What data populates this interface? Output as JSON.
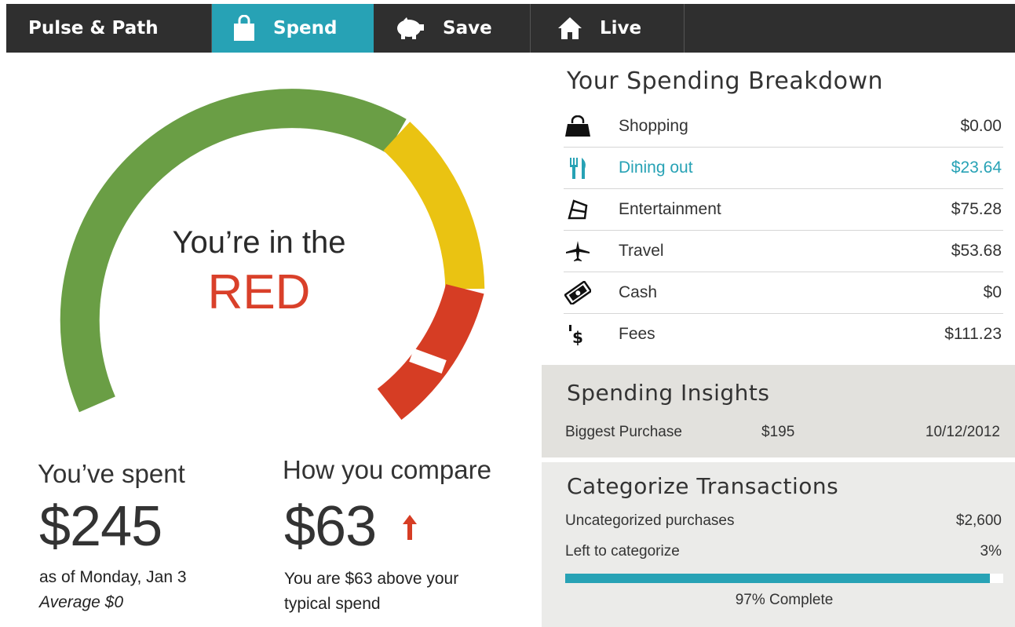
{
  "nav": {
    "brand": "Pulse & Path",
    "tabs": [
      {
        "label": "Spend",
        "icon": "shopping-bag-icon",
        "active": true
      },
      {
        "label": "Save",
        "icon": "piggy-bank-icon",
        "active": false
      },
      {
        "label": "Live",
        "icon": "home-icon",
        "active": false
      }
    ]
  },
  "gauge": {
    "line1": "You’re in the",
    "line2": "RED",
    "status": "red",
    "colors": {
      "green": "#6a9e45",
      "yellow": "#eac312",
      "red": "#d63d24"
    }
  },
  "spent": {
    "heading": "You’ve spent",
    "amount": "$245",
    "as_of": "as of Monday, Jan 3",
    "average": "Average $0"
  },
  "compare": {
    "heading": "How you compare",
    "amount": "$63",
    "line1": "You are $63 above your",
    "line2": "typical spend",
    "direction": "up"
  },
  "breakdown": {
    "title": "Your Spending Breakdown",
    "items": [
      {
        "icon": "shopping-bag-icon",
        "name": "Shopping",
        "amount": "$0.00",
        "highlight": false
      },
      {
        "icon": "fork-knife-icon",
        "name": "Dining out",
        "amount": "$23.64",
        "highlight": true
      },
      {
        "icon": "ticket-icon",
        "name": "Entertainment",
        "amount": "$75.28",
        "highlight": false
      },
      {
        "icon": "airplane-icon",
        "name": "Travel",
        "amount": "$53.68",
        "highlight": false
      },
      {
        "icon": "cash-icon",
        "name": "Cash",
        "amount": "$0",
        "highlight": false
      },
      {
        "icon": "fees-icon",
        "name": "Fees",
        "amount": "$111.23",
        "highlight": false
      }
    ]
  },
  "insights": {
    "title": "Spending Insights",
    "label": "Biggest Purchase",
    "amount": "$195",
    "date": "10/12/2012"
  },
  "categorize": {
    "title": "Categorize Transactions",
    "uncategorized_label": "Uncategorized purchases",
    "uncategorized_value": "$2,600",
    "left_label": "Left to categorize",
    "left_value": "3%",
    "progress": 0.97,
    "complete_label": "97% Complete"
  },
  "accent": "#27a2b5",
  "nav_bg": "#2f2f2f"
}
